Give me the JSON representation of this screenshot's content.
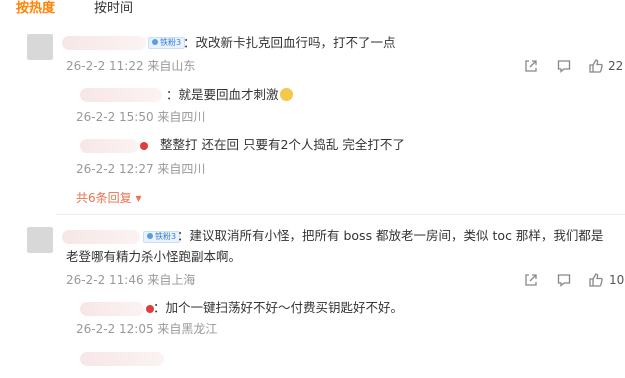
{
  "tabs": {
    "hot": "按热度",
    "time": "按时间"
  },
  "comments": [
    {
      "badge": "铁粉3",
      "text": "：改改新卡扎克回血行吗，打不了一点",
      "meta": "26-2-2 11:22 来自山东",
      "likes": "22",
      "replies": [
        {
          "text": "：就是要回血才刺激",
          "meta": "26-2-2 15:50 来自四川"
        },
        {
          "text": "整整打 还在回 只要有2个人捣乱 完全打不了",
          "meta": "26-2-2 12:27 来自四川"
        }
      ],
      "more_replies": "共6条回复"
    },
    {
      "badge": "铁粉3",
      "text_line1": "：建议取消所有小怪，把所有 boss 都放老一房间，类似 toc 那样，我们都是",
      "text_line2": "老登哪有精力杀小怪跑副本啊。",
      "meta": "26-2-2 11:46 来自上海",
      "likes": "10",
      "replies": [
        {
          "text": "：加个一键扫荡好不好～付费买钥匙好不好。",
          "meta": "26-2-2 12:05 来自黑龙江"
        }
      ]
    }
  ],
  "icons": {
    "share": "share-icon",
    "comment": "comment-icon",
    "like": "thumb-up-icon"
  },
  "colors": {
    "accent": "#ff8200",
    "more": "#eb7350",
    "meta": "#999999"
  }
}
